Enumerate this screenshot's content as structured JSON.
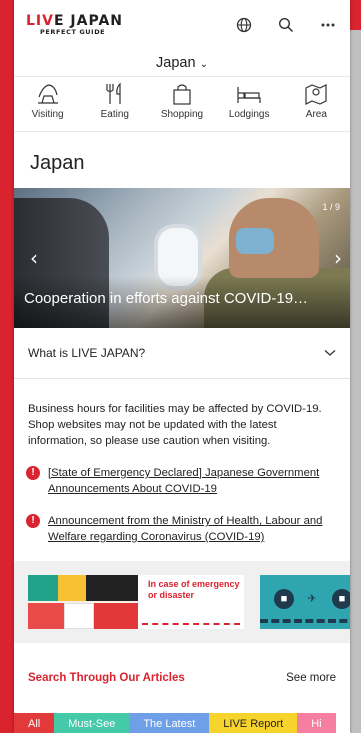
{
  "header": {
    "logo_main_a": "LI",
    "logo_main_v": "V",
    "logo_main_b": "E JAPAN",
    "logo_sub": "PERFECT GUIDE"
  },
  "selector": {
    "label": "Japan"
  },
  "categories": [
    {
      "label": "Visiting",
      "icon": "visiting-icon"
    },
    {
      "label": "Eating",
      "icon": "eating-icon"
    },
    {
      "label": "Shopping",
      "icon": "shopping-icon"
    },
    {
      "label": "Lodgings",
      "icon": "lodgings-icon"
    },
    {
      "label": "Area",
      "icon": "area-icon"
    }
  ],
  "page_title": "Japan",
  "hero": {
    "counter": "1 / 9",
    "caption": "Cooperation in efforts against COVID-19…"
  },
  "accordion": {
    "label": "What is LIVE JAPAN?"
  },
  "notice": "Business hours for facilities may be affected by COVID-19. Shop websites may not be updated with the latest information, so please use caution when visiting.",
  "alerts": [
    {
      "text": "[State of Emergency Declared] Japanese Government Announcements About COVID-19"
    },
    {
      "text": "Announcement from the Ministry of Health, Labour and Welfare regarding Coronavirus (COVID-19)"
    }
  ],
  "banner": {
    "text": "In case of emergency or disaster"
  },
  "section": {
    "title": "Search Through Our Articles",
    "more": "See more"
  },
  "tabs": [
    {
      "label": "All",
      "color": "#e23a3a"
    },
    {
      "label": "Must-See",
      "color": "#44c9a9"
    },
    {
      "label": "The Latest",
      "color": "#6f9fe6"
    },
    {
      "label": "LIVE Report",
      "color": "#f7d42b",
      "text": "#222222"
    },
    {
      "label": "Hi",
      "color": "#f47fa0"
    }
  ]
}
